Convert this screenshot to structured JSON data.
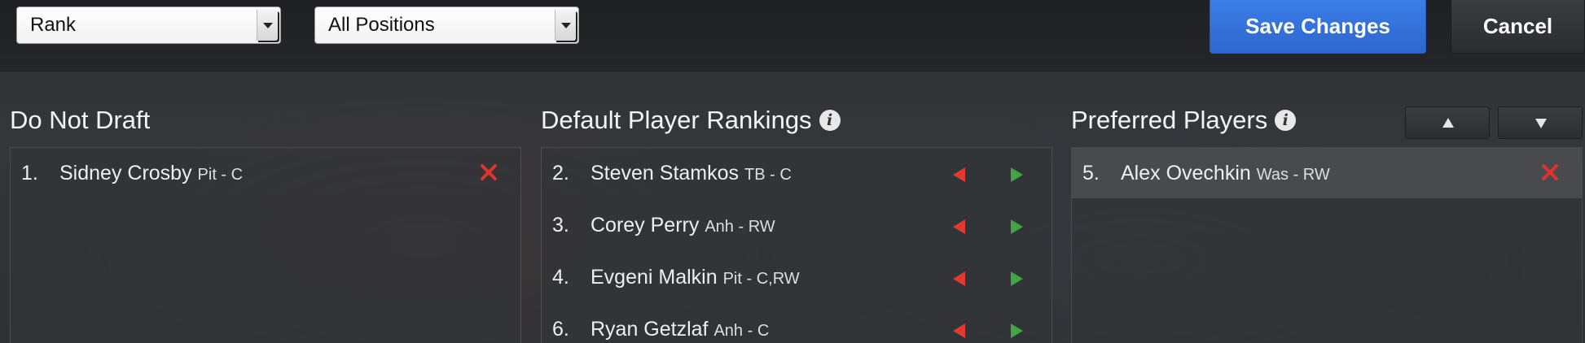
{
  "toolbar": {
    "sort_select": {
      "value": "Rank"
    },
    "position_select": {
      "value": "All Positions"
    },
    "save_label": "Save Changes",
    "cancel_label": "Cancel"
  },
  "columns": {
    "do_not_draft": {
      "title": "Do Not Draft",
      "players": [
        {
          "rank": "1.",
          "name": "Sidney Crosby",
          "meta": "Pit - C"
        }
      ]
    },
    "default_rankings": {
      "title": "Default Player Rankings",
      "players": [
        {
          "rank": "2.",
          "name": "Steven Stamkos",
          "meta": "TB - C"
        },
        {
          "rank": "3.",
          "name": "Corey Perry",
          "meta": "Anh - RW"
        },
        {
          "rank": "4.",
          "name": "Evgeni Malkin",
          "meta": "Pit - C,RW"
        },
        {
          "rank": "6.",
          "name": "Ryan Getzlaf",
          "meta": "Anh - C"
        }
      ]
    },
    "preferred_players": {
      "title": "Preferred Players",
      "players": [
        {
          "rank": "5.",
          "name": "Alex Ovechkin",
          "meta": "Was - RW"
        }
      ]
    }
  },
  "colors": {
    "accent_blue": "#3070dc",
    "remove_red": "#e0332f",
    "move_left_red": "#e03a33",
    "move_right_green": "#3fa545"
  },
  "icons": {
    "info": "info-icon",
    "remove": "close-icon",
    "move_left": "arrow-left-icon",
    "move_right": "arrow-right-icon",
    "move_up": "arrow-up-icon",
    "move_down": "arrow-down-icon",
    "dropdown": "chevron-down-icon"
  }
}
